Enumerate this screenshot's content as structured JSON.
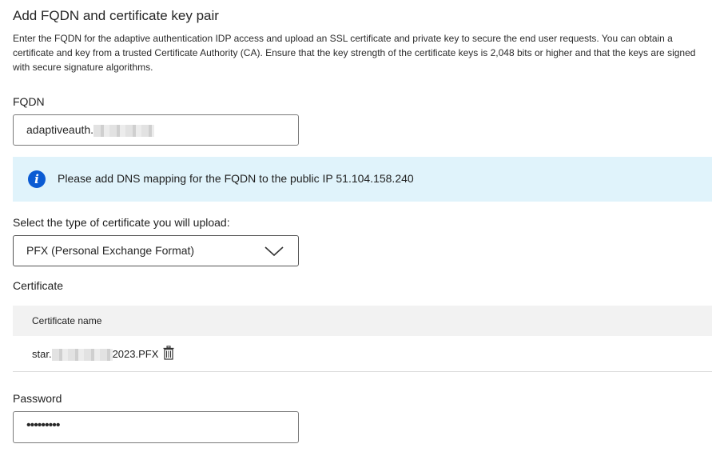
{
  "header": {
    "title": "Add FQDN and certificate key pair",
    "description": "Enter the FQDN for the adaptive authentication IDP access and upload an SSL certificate and private key to secure the end user requests. You can obtain a certificate and key from a trusted Certificate Authority (CA). Ensure that the key strength of the certificate keys is 2,048 bits or higher and that the keys are signed with secure signature algorithms."
  },
  "fqdn": {
    "label": "FQDN",
    "value_visible": "adaptiveauth."
  },
  "info_banner": {
    "icon": "info-icon",
    "text": "Please add DNS mapping for the FQDN to the public IP 51.104.158.240",
    "accent_color": "#0b5bd3",
    "background_color": "#e0f3fb"
  },
  "cert_type": {
    "label": "Select the type of certificate you will upload:",
    "selected": "PFX (Personal Exchange Format)"
  },
  "certificate": {
    "label": "Certificate",
    "table": {
      "column_header": "Certificate name",
      "rows": [
        {
          "name_prefix": "star.",
          "name_suffix": "2023.PFX",
          "action_icon": "trash-icon"
        }
      ]
    }
  },
  "password": {
    "label": "Password",
    "masked_value": "•••••••••"
  }
}
